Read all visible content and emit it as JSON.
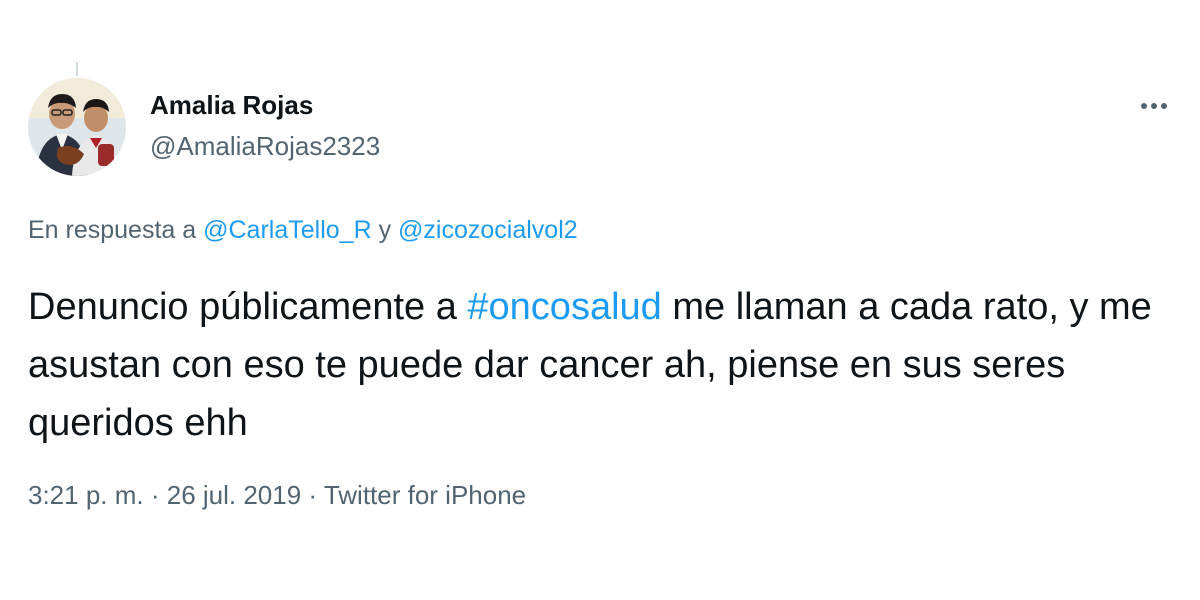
{
  "tweet": {
    "author": {
      "display_name": "Amalia Rojas",
      "handle": "@AmaliaRojas2323"
    },
    "reply_to": {
      "prefix": "En respuesta a ",
      "mention_1": "@CarlaTello_R",
      "connector": " y ",
      "mention_2": "@zicozocialvol2"
    },
    "text": {
      "part_1": "Denuncio públicamente a ",
      "hashtag": "#oncosalud",
      "part_2": " me llaman a cada rato, y me asustan con eso te puede dar cancer ah, piense en sus seres queridos ehh"
    },
    "meta": {
      "time": "3:21 p. m.",
      "separator": " · ",
      "date": "26 jul. 2019",
      "source": "Twitter for iPhone"
    },
    "icons": {
      "more": "more-horizontal-icon",
      "avatar": "profile-avatar"
    },
    "colors": {
      "link": "#1d9bf0",
      "secondary_text": "#536471",
      "primary_text": "#0f1419"
    }
  }
}
